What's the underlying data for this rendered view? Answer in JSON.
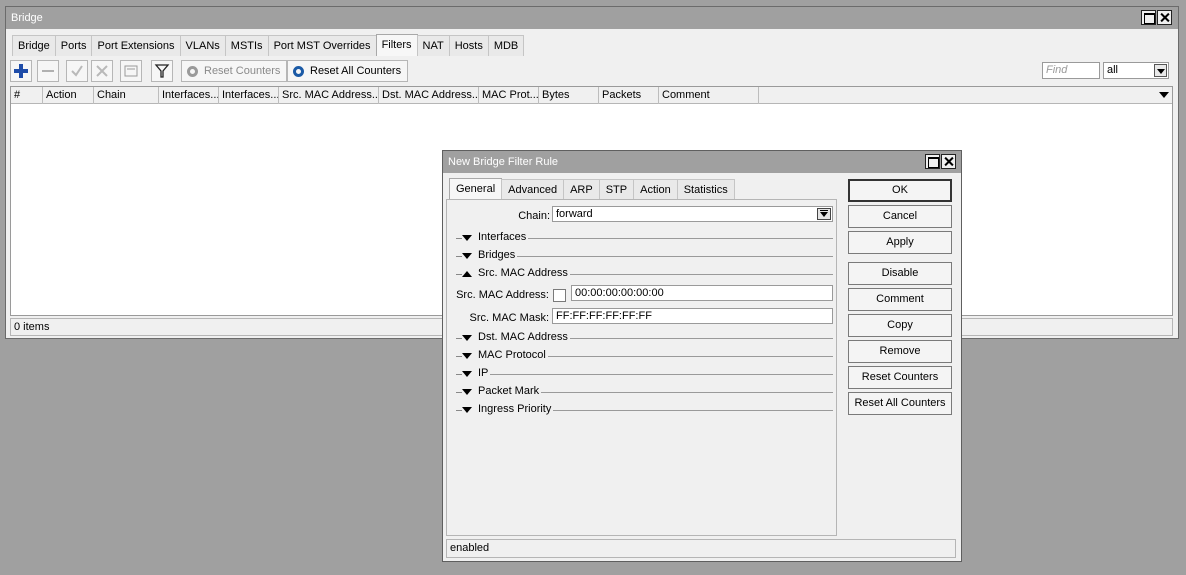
{
  "main_window": {
    "title": "Bridge",
    "tabs": [
      "Bridge",
      "Ports",
      "Port Extensions",
      "VLANs",
      "MSTIs",
      "Port MST Overrides",
      "Filters",
      "NAT",
      "Hosts",
      "MDB"
    ],
    "active_tab": "Filters",
    "toolbar": {
      "add_icon": "plus-icon",
      "remove_icon": "minus-icon",
      "enable_icon": "check-icon",
      "disable_icon": "x-icon",
      "comment_icon": "note-icon",
      "filter_icon": "filter-icon",
      "reset_counters": "Reset Counters",
      "reset_all_counters": "Reset All Counters",
      "find_placeholder": "Find",
      "filter_select": "all"
    },
    "columns": [
      "#",
      "Action",
      "Chain",
      "Interfaces...",
      "Interfaces...",
      "Src. MAC Address...",
      "Dst. MAC Address...",
      "MAC Prot...",
      "Bytes",
      "Packets",
      "Comment"
    ],
    "status": "0 items"
  },
  "dialog": {
    "title": "New Bridge Filter Rule",
    "tabs": [
      "General",
      "Advanced",
      "ARP",
      "STP",
      "Action",
      "Statistics"
    ],
    "active_tab": "General",
    "chain_label": "Chain:",
    "chain_value": "forward",
    "sections": {
      "interfaces": "Interfaces",
      "bridges": "Bridges",
      "src_mac": "Src. MAC Address",
      "dst_mac": "Dst. MAC Address",
      "mac_protocol": "MAC Protocol",
      "ip": "IP",
      "packet_mark": "Packet Mark",
      "ingress_priority": "Ingress Priority"
    },
    "src_mac_address_label": "Src. MAC Address:",
    "src_mac_address_value": "00:00:00:00:00:00",
    "src_mac_mask_label": "Src. MAC Mask:",
    "src_mac_mask_value": "FF:FF:FF:FF:FF:FF",
    "buttons": [
      "OK",
      "Cancel",
      "Apply",
      "Disable",
      "Comment",
      "Copy",
      "Remove",
      "Reset Counters",
      "Reset All Counters"
    ],
    "status": "enabled"
  }
}
